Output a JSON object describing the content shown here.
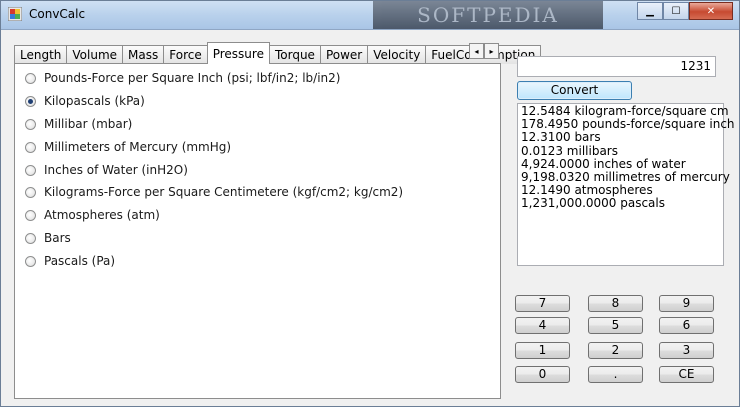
{
  "window": {
    "title": "ConvCalc",
    "watermark": "SOFTPEDIA"
  },
  "caption": {
    "minimize": "▁",
    "maximize": "☐",
    "close": "✕"
  },
  "tabs": [
    {
      "label": "Length"
    },
    {
      "label": "Volume"
    },
    {
      "label": "Mass"
    },
    {
      "label": "Force"
    },
    {
      "label": "Pressure",
      "active": true
    },
    {
      "label": "Torque"
    },
    {
      "label": "Power"
    },
    {
      "label": "Velocity"
    },
    {
      "label": "FuelConsumption"
    }
  ],
  "tab_scroll": {
    "left": "◂",
    "right": "▸"
  },
  "units": [
    {
      "label": "Pounds-Force per Square Inch (psi; lbf/in2; lb/in2)",
      "checked": false
    },
    {
      "label": "Kilopascals (kPa)",
      "checked": true
    },
    {
      "label": "Millibar (mbar)",
      "checked": false
    },
    {
      "label": "Millimeters of Mercury (mmHg)",
      "checked": false
    },
    {
      "label": "Inches of Water (inH2O)",
      "checked": false
    },
    {
      "label": "Kilograms-Force per Square Centimetere (kgf/cm2; kg/cm2)",
      "checked": false
    },
    {
      "label": "Atmospheres (atm)",
      "checked": false
    },
    {
      "label": "Bars",
      "checked": false
    },
    {
      "label": "Pascals (Pa)",
      "checked": false
    }
  ],
  "input": {
    "value": "1231"
  },
  "convert_label": "Convert",
  "results": [
    "12.5484 kilogram-force/square cm",
    "178.4950 pounds-force/square inch",
    "12.3100 bars",
    "0.0123 millibars",
    "4,924.0000 inches of water",
    "9,198.0320 millimetres of mercury",
    "12.1490 atmospheres",
    "1,231,000.0000 pascals"
  ],
  "keypad": {
    "k7": "7",
    "k8": "8",
    "k9": "9",
    "k4": "4",
    "k5": "5",
    "k6": "6",
    "k1": "1",
    "k2": "2",
    "k3": "3",
    "k0": "0",
    "kdot": ".",
    "kce": "CE"
  }
}
